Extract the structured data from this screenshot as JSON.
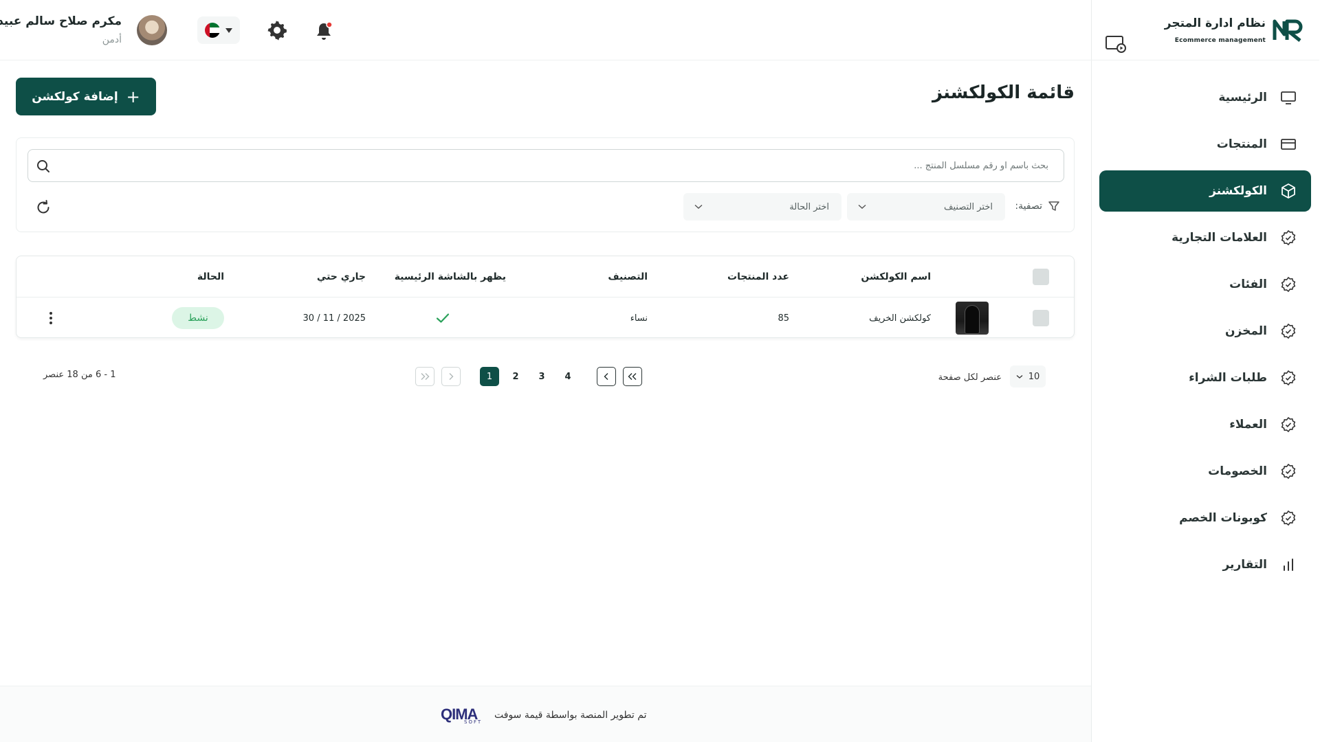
{
  "brand": {
    "title": "نظام ادارة المتجر",
    "subtitle": "Ecommerce management",
    "logo_text": "NR"
  },
  "sidebar": {
    "items": [
      {
        "label": "الرئيسية",
        "icon": "monitor-icon",
        "active": false
      },
      {
        "label": "المنتجات",
        "icon": "card-icon",
        "active": false
      },
      {
        "label": "الكولكشنز",
        "icon": "box-icon",
        "active": true
      },
      {
        "label": "العلامات التجارية",
        "icon": "badge-icon",
        "active": false
      },
      {
        "label": "الفئات",
        "icon": "badge-icon",
        "active": false
      },
      {
        "label": "المخزن",
        "icon": "badge-icon",
        "active": false
      },
      {
        "label": "طلبات الشراء",
        "icon": "badge-icon",
        "active": false
      },
      {
        "label": "العملاء",
        "icon": "badge-icon",
        "active": false
      },
      {
        "label": "الخصومات",
        "icon": "badge-icon",
        "active": false
      },
      {
        "label": "كوبونات الخصم",
        "icon": "badge-icon",
        "active": false
      },
      {
        "label": "التقارير",
        "icon": "chart-bars-icon",
        "active": false
      }
    ]
  },
  "header": {
    "user_name": "مكرم صلاح سالم عبيد",
    "user_role": "أدمن",
    "language_flag": "uae-flag-icon"
  },
  "main": {
    "page_title": "قائمة الكولكشنز",
    "add_button_label": "إضافة كولكشن",
    "search_placeholder": "بحث باسم او رقم مسلسل المنتج ...",
    "filter_label": "تصفية:",
    "category_select_placeholder": "اختر التصنيف",
    "status_select_placeholder": "اختر الحالة"
  },
  "table": {
    "columns": [
      "اسم الكولكشن",
      "عدد المنتجات",
      "التصنيف",
      "يظهر بالشاشة الرئيسية",
      "جاري حتي",
      "الحالة"
    ],
    "rows": [
      {
        "name": "كولكشن الخريف",
        "product_count": "85",
        "category": "نساء",
        "shown_on_home": true,
        "valid_until": "30 / 11 / 2025",
        "status": "نشط"
      }
    ]
  },
  "pagination": {
    "per_page_label": "عنصر لكل صفحة",
    "per_page_value": "10",
    "pages": [
      "1",
      "2",
      "3",
      "4"
    ],
    "current_page": "1",
    "range_text": "1 - 6 من 18 عنصر"
  },
  "footer": {
    "text": "تم تطوير المنصة بواسطة قيمة سوفت",
    "logo_text": "QIMA",
    "logo_sub": "SOFT"
  },
  "colors": {
    "primary": "#0e4f47",
    "status_active_bg": "#dcf5e6",
    "status_active_text": "#2aa15a",
    "check": "#2aa15a"
  }
}
